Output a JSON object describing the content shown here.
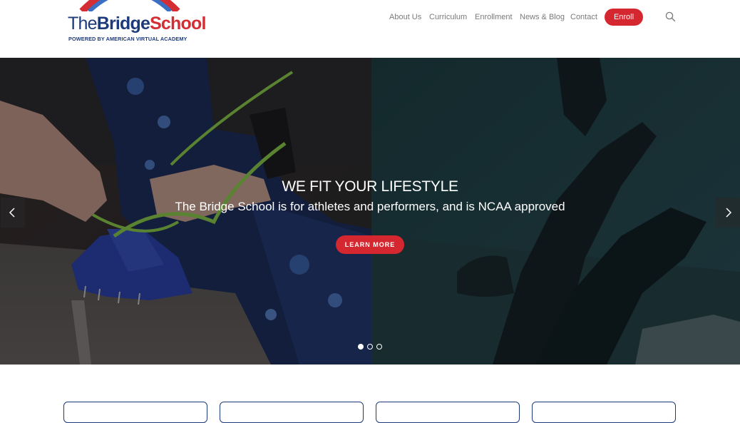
{
  "brand": {
    "name_the": "The",
    "name_bridge": "Bridge",
    "name_school": "School",
    "tagline": "POWERED BY AMERICAN VIRTUAL ACADEMY",
    "colors": {
      "navy": "#1d3a7b",
      "red": "#d42e34"
    }
  },
  "nav": {
    "items": [
      {
        "label": "About Us"
      },
      {
        "label": "Curriculum"
      },
      {
        "label": "Enrollment"
      },
      {
        "label": "News & Blog"
      },
      {
        "label": "Contact"
      }
    ],
    "enroll_label": "Enroll",
    "search_icon": "search-icon"
  },
  "hero": {
    "heading": "WE FIT YOUR LIFESTYLE",
    "subheading": "The Bridge School is for athletes and performers, and is NCAA approved",
    "cta_label": "LEARN MORE",
    "prev_icon": "chevron-left-icon",
    "next_icon": "chevron-right-icon",
    "slide_count": 3,
    "active_slide": 1,
    "accent_color": "#d4272f"
  },
  "cards": {
    "count": 4
  }
}
